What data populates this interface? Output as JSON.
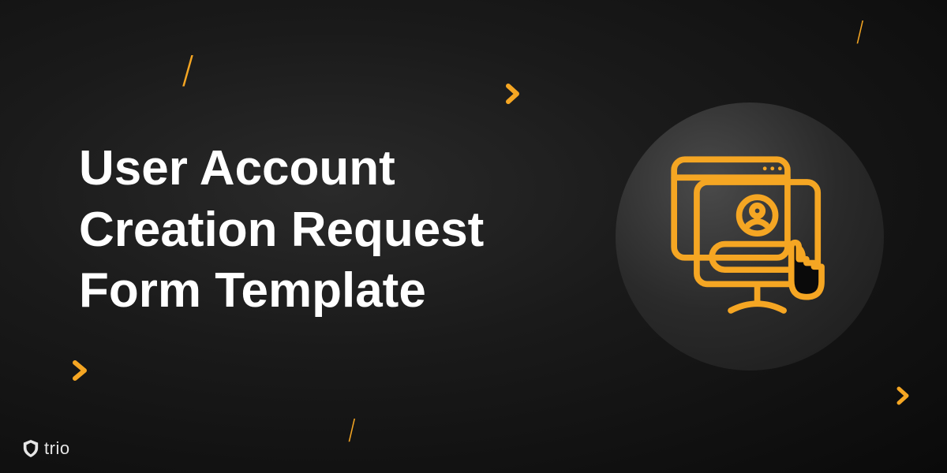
{
  "title": "User Account Creation Request Form Template",
  "brand": "trio",
  "accent_color": "#f5a623",
  "decorations": {
    "slash_1": "/",
    "slash_2": "/",
    "slash_3": "/"
  }
}
